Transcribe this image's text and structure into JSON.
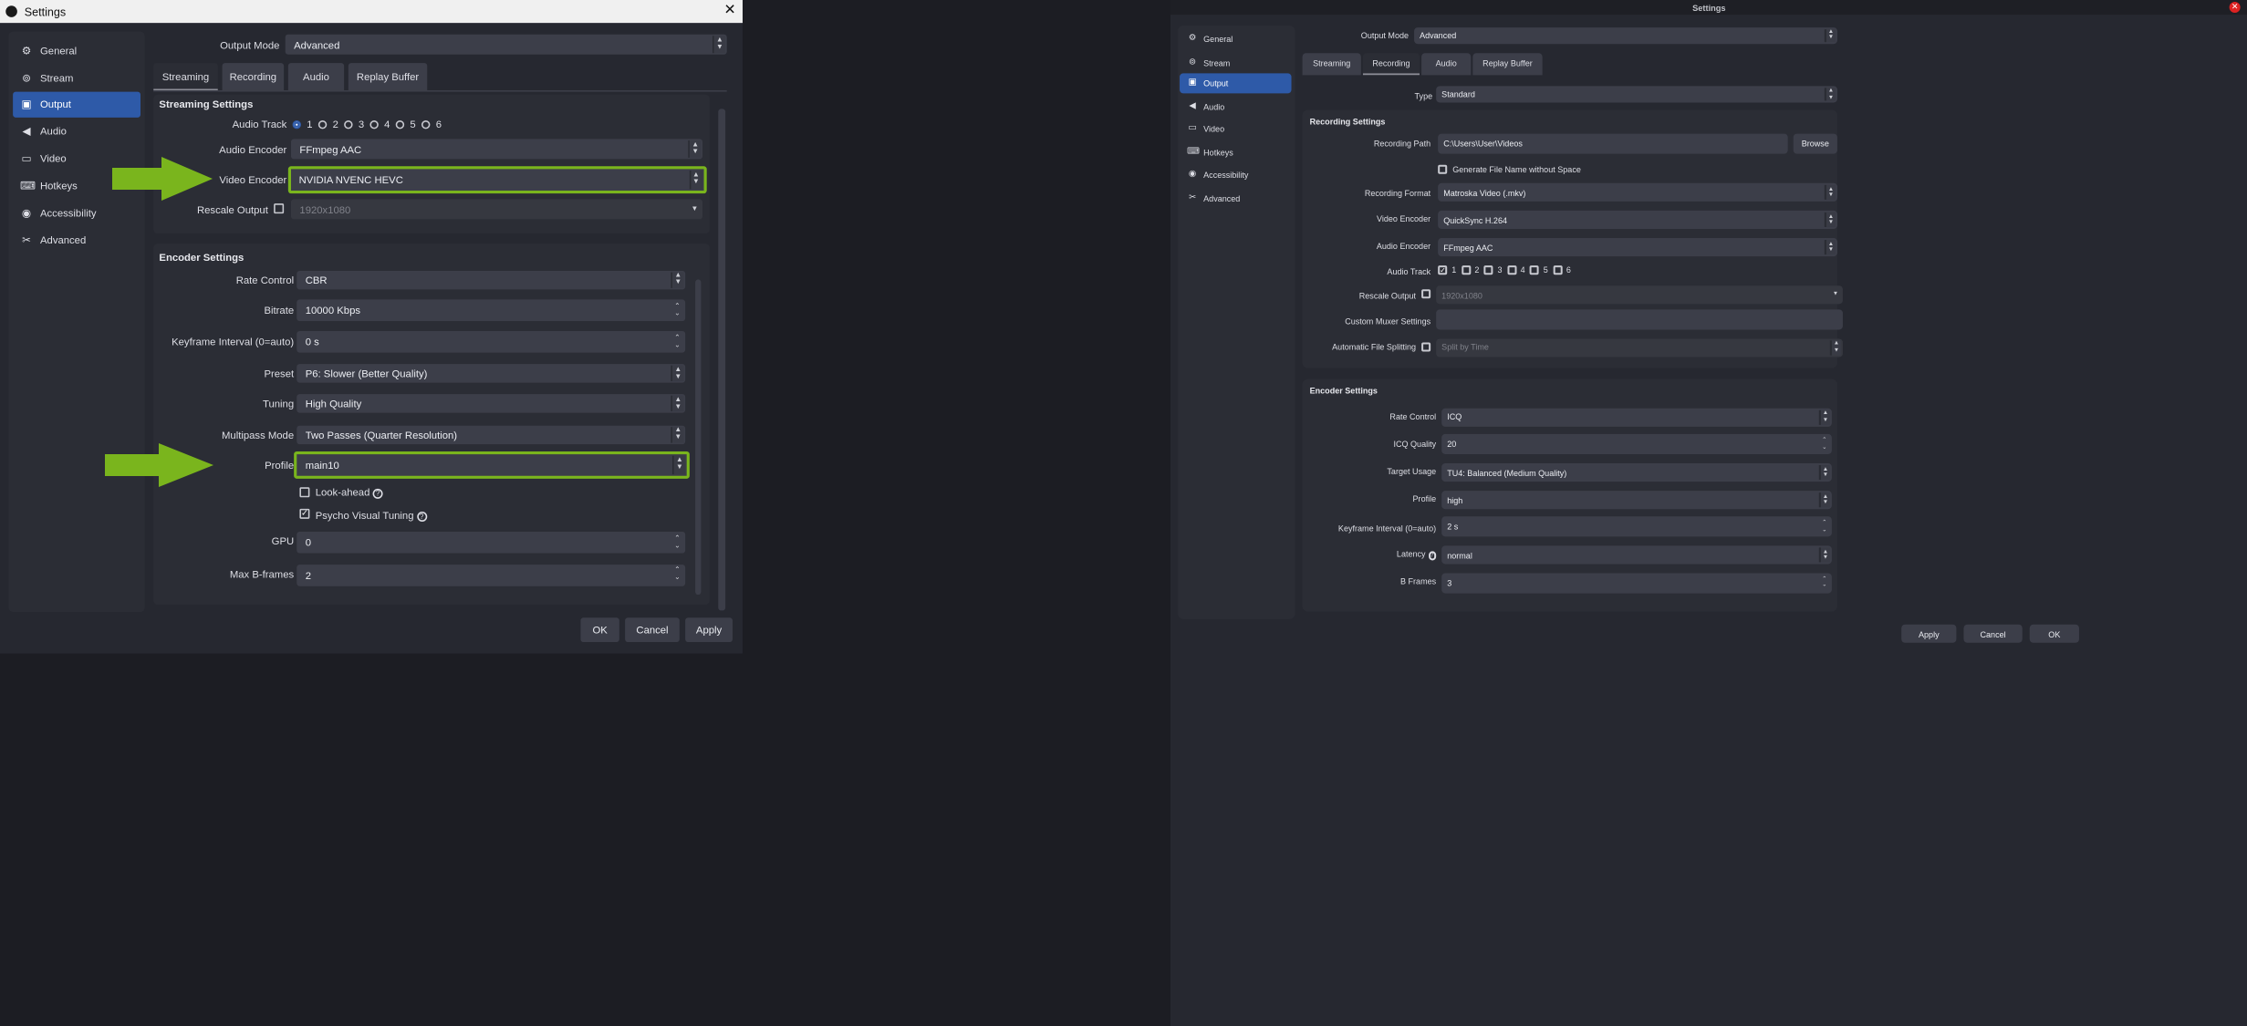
{
  "colors": {
    "accent": "#2e5aa8",
    "highlight": "#7ab51d",
    "panel": "#2b2d35",
    "background": "#262830"
  },
  "left": {
    "title": "Settings",
    "sidebar": [
      {
        "label": "General",
        "icon": "gear-icon"
      },
      {
        "label": "Stream",
        "icon": "antenna-icon"
      },
      {
        "label": "Output",
        "icon": "monitor-icon",
        "selected": true
      },
      {
        "label": "Audio",
        "icon": "speaker-icon"
      },
      {
        "label": "Video",
        "icon": "screen-icon"
      },
      {
        "label": "Hotkeys",
        "icon": "keyboard-icon"
      },
      {
        "label": "Accessibility",
        "icon": "accessibility-icon"
      },
      {
        "label": "Advanced",
        "icon": "tools-icon"
      }
    ],
    "output_mode_label": "Output Mode",
    "output_mode_value": "Advanced",
    "tabs": [
      "Streaming",
      "Recording",
      "Audio",
      "Replay Buffer"
    ],
    "streaming": {
      "title": "Streaming Settings",
      "audio_track_label": "Audio Track",
      "audio_tracks": [
        "1",
        "2",
        "3",
        "4",
        "5",
        "6"
      ],
      "audio_track_selected": "1",
      "audio_encoder_label": "Audio Encoder",
      "audio_encoder_value": "FFmpeg AAC",
      "video_encoder_label": "Video Encoder",
      "video_encoder_value": "NVIDIA NVENC HEVC",
      "rescale_label": "Rescale Output",
      "rescale_value": "1920x1080"
    },
    "encoder": {
      "title": "Encoder Settings",
      "rate_control_label": "Rate Control",
      "rate_control_value": "CBR",
      "bitrate_label": "Bitrate",
      "bitrate_value": "10000 Kbps",
      "keyframe_label": "Keyframe Interval (0=auto)",
      "keyframe_value": "0 s",
      "preset_label": "Preset",
      "preset_value": "P6: Slower (Better Quality)",
      "tuning_label": "Tuning",
      "tuning_value": "High Quality",
      "multipass_label": "Multipass Mode",
      "multipass_value": "Two Passes (Quarter Resolution)",
      "profile_label": "Profile",
      "profile_value": "main10",
      "lookahead_label": "Look-ahead",
      "psycho_label": "Psycho Visual Tuning",
      "gpu_label": "GPU",
      "gpu_value": "0",
      "bframes_label": "Max B-frames",
      "bframes_value": "2"
    },
    "buttons": {
      "ok": "OK",
      "cancel": "Cancel",
      "apply": "Apply"
    }
  },
  "right": {
    "title": "Settings",
    "sidebar": [
      {
        "label": "General",
        "icon": "gear-icon"
      },
      {
        "label": "Stream",
        "icon": "antenna-icon"
      },
      {
        "label": "Output",
        "icon": "monitor-icon",
        "selected": true
      },
      {
        "label": "Audio",
        "icon": "speaker-icon"
      },
      {
        "label": "Video",
        "icon": "screen-icon"
      },
      {
        "label": "Hotkeys",
        "icon": "keyboard-icon"
      },
      {
        "label": "Accessibility",
        "icon": "accessibility-icon"
      },
      {
        "label": "Advanced",
        "icon": "tools-icon"
      }
    ],
    "output_mode_label": "Output Mode",
    "output_mode_value": "Advanced",
    "tabs": [
      "Streaming",
      "Recording",
      "Audio",
      "Replay Buffer"
    ],
    "type_label": "Type",
    "type_value": "Standard",
    "recording": {
      "title": "Recording Settings",
      "path_label": "Recording Path",
      "path_value": "C:\\Users\\User\\Videos",
      "browse": "Browse",
      "gen_name_label": "Generate File Name without Space",
      "format_label": "Recording Format",
      "format_value": "Matroska Video (.mkv)",
      "video_encoder_label": "Video Encoder",
      "video_encoder_value": "QuickSync H.264",
      "audio_encoder_label": "Audio Encoder",
      "audio_encoder_value": "FFmpeg AAC",
      "audio_track_label": "Audio Track",
      "audio_tracks": [
        "1",
        "2",
        "3",
        "4",
        "5",
        "6"
      ],
      "rescale_label": "Rescale Output",
      "rescale_value": "1920x1080",
      "muxer_label": "Custom Muxer Settings",
      "split_label": "Automatic File Splitting",
      "split_value": "Split by Time"
    },
    "encoder": {
      "title": "Encoder Settings",
      "rate_control_label": "Rate Control",
      "rate_control_value": "ICQ",
      "icq_label": "ICQ Quality",
      "icq_value": "20",
      "target_label": "Target Usage",
      "target_value": "TU4: Balanced (Medium Quality)",
      "profile_label": "Profile",
      "profile_value": "high",
      "keyframe_label": "Keyframe Interval (0=auto)",
      "keyframe_value": "2 s",
      "latency_label": "Latency",
      "latency_value": "normal",
      "bframes_label": "B Frames",
      "bframes_value": "3"
    },
    "buttons": {
      "apply": "Apply",
      "cancel": "Cancel",
      "ok": "OK"
    }
  }
}
